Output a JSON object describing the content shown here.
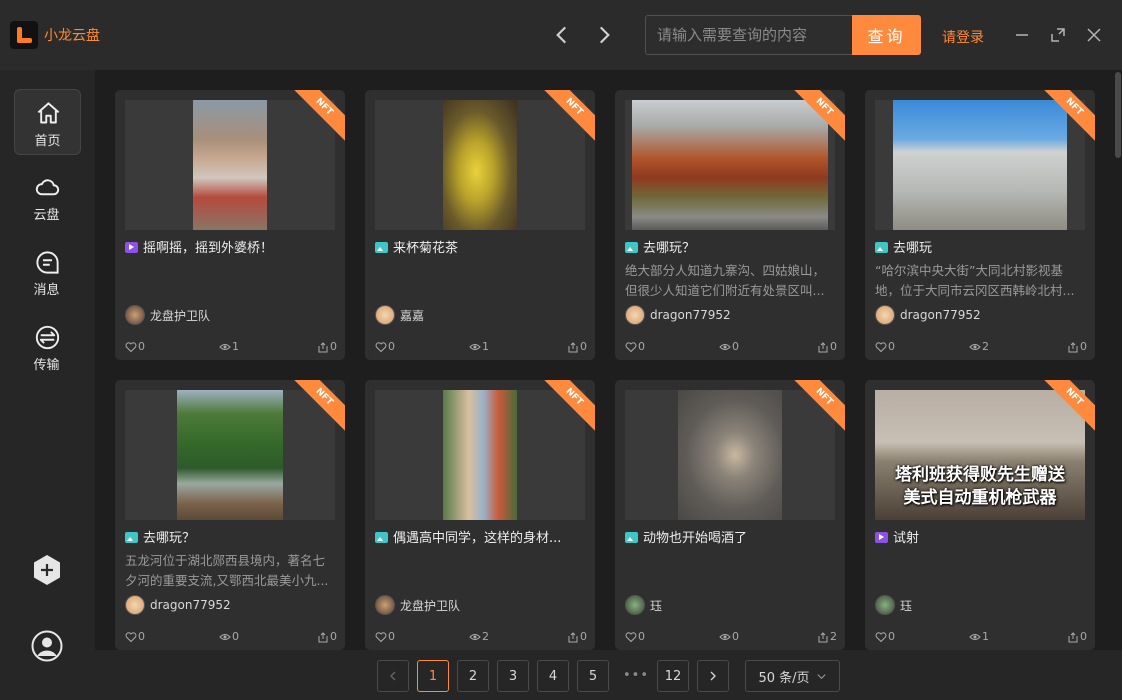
{
  "app": {
    "title": "小龙云盘",
    "accent": "#ff8a3d"
  },
  "header": {
    "search_placeholder": "请输入需要查询的内容",
    "search_button": "查询",
    "login": "请登录"
  },
  "sidebar": {
    "items": [
      {
        "label": "首页",
        "icon": "home-icon",
        "active": true
      },
      {
        "label": "云盘",
        "icon": "cloud-icon",
        "active": false
      },
      {
        "label": "消息",
        "icon": "message-icon",
        "active": false
      },
      {
        "label": "传输",
        "icon": "transfer-icon",
        "active": false
      }
    ]
  },
  "cards": [
    {
      "type": "video",
      "title": "摇啊摇，摇到外婆桥！",
      "desc": [],
      "user": "龙盘护卫队",
      "likes": "0",
      "views": "1",
      "shares": "0",
      "badge": "NFT"
    },
    {
      "type": "image",
      "title": "来杯菊花茶",
      "desc": [],
      "user": "嘉嘉",
      "likes": "0",
      "views": "1",
      "shares": "0",
      "badge": "NFT"
    },
    {
      "type": "image",
      "title": "去哪玩？",
      "desc": [
        "绝大部分人知道九寨沟、四姑娘山，",
        "但很少人知道它们附近有处景区叫..."
      ],
      "user": "dragon77952",
      "likes": "0",
      "views": "0",
      "shares": "0",
      "badge": "NFT"
    },
    {
      "type": "image",
      "title": "去哪玩",
      "desc": [
        "“哈尔滨中央大街”大同北村影视基",
        "地，位于大同市云冈区西韩岭北村..."
      ],
      "user": "dragon77952",
      "likes": "0",
      "views": "2",
      "shares": "0",
      "badge": "NFT"
    },
    {
      "type": "image",
      "title": "去哪玩？",
      "desc": [
        "五龙河位于湖北郧西县境内，著名七",
        "夕河的重要支流,又鄂西北最美小九..."
      ],
      "user": "dragon77952",
      "likes": "0",
      "views": "0",
      "shares": "0",
      "badge": "NFT"
    },
    {
      "type": "image",
      "title": "偶遇高中同学，这样的身材...",
      "desc": [],
      "user": "龙盘护卫队",
      "likes": "0",
      "views": "2",
      "shares": "0",
      "badge": "NFT"
    },
    {
      "type": "image",
      "title": "动物也开始喝酒了",
      "desc": [],
      "user": "珏",
      "likes": "0",
      "views": "0",
      "shares": "2",
      "badge": "NFT"
    },
    {
      "type": "video",
      "title": "试射",
      "desc": [],
      "user": "珏",
      "likes": "0",
      "views": "1",
      "shares": "0",
      "badge": "NFT",
      "overlay": [
        "塔利班获得败先生赠送",
        "美式自动重机枪武器"
      ]
    }
  ],
  "pagination": {
    "pages": [
      "1",
      "2",
      "3",
      "4",
      "5"
    ],
    "dots": "•••",
    "last": "12",
    "page_size": "50 条/页",
    "current": "1"
  }
}
